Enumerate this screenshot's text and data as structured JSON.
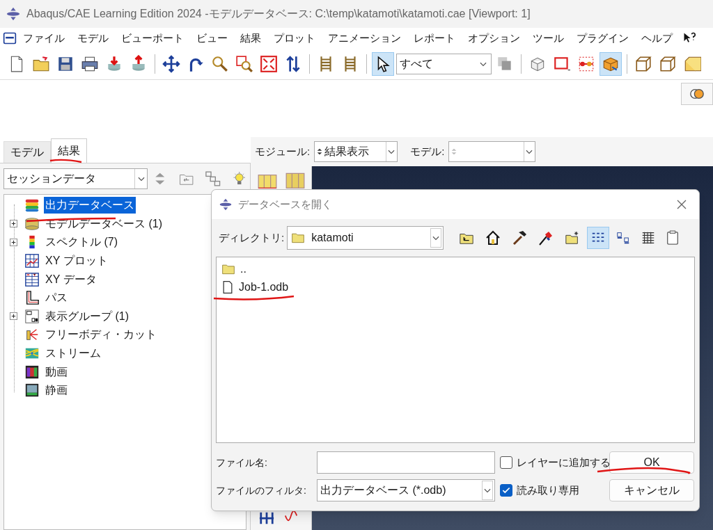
{
  "window": {
    "title": "Abaqus/CAE Learning Edition 2024 -モデルデータベース: C:\\temp\\katamoti\\katamoti.cae [Viewport: 1]"
  },
  "menu_bar": [
    "ファイル",
    "モデル",
    "ビューポート",
    "ビュー",
    "結果",
    "プロット",
    "アニメーション",
    "レポート",
    "オプション",
    "ツール",
    "プラグイン",
    "ヘルプ"
  ],
  "toolbar": {
    "buttons": [
      {
        "kind": "page",
        "selected": false
      },
      {
        "kind": "folder",
        "selected": false
      },
      {
        "kind": "disk",
        "selected": false
      },
      {
        "kind": "printer",
        "selected": false
      },
      {
        "kind": "stack-down",
        "selected": false
      },
      {
        "kind": "stack-up",
        "selected": false
      },
      {
        "kind": "sep"
      },
      {
        "kind": "cross-arrows",
        "selected": false
      },
      {
        "kind": "curve-arrow",
        "selected": false
      },
      {
        "kind": "magnifier",
        "selected": false
      },
      {
        "kind": "box-magnifier",
        "selected": false
      },
      {
        "kind": "fit",
        "selected": false
      },
      {
        "kind": "updown",
        "selected": false
      },
      {
        "kind": "sep"
      },
      {
        "kind": "ladder",
        "selected": false
      },
      {
        "kind": "ladder",
        "selected": false
      },
      {
        "kind": "sep"
      },
      {
        "kind": "pointer",
        "selected": true
      },
      {
        "kind": "combo"
      },
      {
        "kind": "grey-squares",
        "selected": false
      },
      {
        "kind": "sep"
      },
      {
        "kind": "wire-box",
        "selected": false
      },
      {
        "kind": "dashed-rect",
        "selected": false
      },
      {
        "kind": "nodes",
        "selected": false
      },
      {
        "kind": "solid-box",
        "selected": true
      },
      {
        "kind": "sep"
      },
      {
        "kind": "wire-cube",
        "selected": false
      },
      {
        "kind": "wire-cube",
        "selected": false
      },
      {
        "kind": "yellow-cube",
        "selected": false
      }
    ],
    "selection_filter": "すべて"
  },
  "tabs": [
    {
      "label": "モデル",
      "selected": false
    },
    {
      "label": "結果",
      "selected": true
    }
  ],
  "tree_filter": "セッションデータ",
  "tree": [
    {
      "label": "出力データベース",
      "expandable": false,
      "selected": true
    },
    {
      "label": "モデルデータベース (1)",
      "expandable": true,
      "selected": false
    },
    {
      "label": "スペクトル (7)",
      "expandable": true,
      "selected": false
    },
    {
      "label": "XY プロット",
      "expandable": false,
      "selected": false
    },
    {
      "label": "XY データ",
      "expandable": false,
      "selected": false
    },
    {
      "label": "パス",
      "expandable": false,
      "selected": false
    },
    {
      "label": "表示グループ (1)",
      "expandable": true,
      "selected": false
    },
    {
      "label": "フリーボディ・カット",
      "expandable": false,
      "selected": false
    },
    {
      "label": "ストリーム",
      "expandable": false,
      "selected": false
    },
    {
      "label": "動画",
      "expandable": false,
      "selected": false
    },
    {
      "label": "静画",
      "expandable": false,
      "selected": false
    }
  ],
  "context_bar": {
    "module_label": "モジュール:",
    "module": "結果表示",
    "model_label": "モデル:"
  },
  "dialog": {
    "title": "データベースを開く",
    "directory_label": "ディレクトリ:",
    "directory": "katamoti",
    "view_buttons": [
      {
        "kind": "details",
        "selected": true
      },
      {
        "kind": "icons",
        "selected": false
      },
      {
        "kind": "list",
        "selected": false
      }
    ],
    "files": [
      {
        "name": "..",
        "kind": "folder"
      },
      {
        "name": "Job-1.odb",
        "kind": "file"
      }
    ],
    "file_name_label": "ファイル名:",
    "filter_label": "ファイルのフィルタ:",
    "filter": "出力データベース (*.odb)",
    "add_layer": {
      "label": "レイヤーに追加する",
      "checked": false
    },
    "read_only": {
      "label": "読み取り専用",
      "checked": true
    },
    "ok": "OK",
    "cancel": "キャンセル"
  }
}
